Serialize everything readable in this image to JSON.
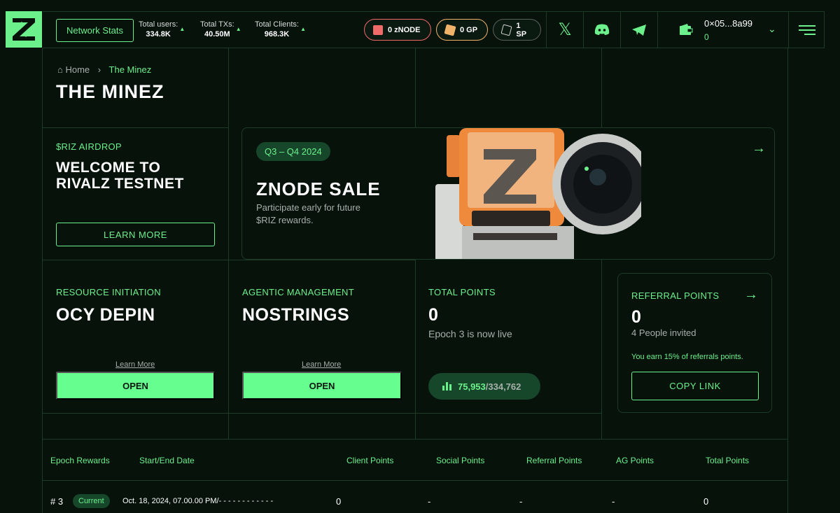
{
  "header": {
    "network_stats_label": "Network Stats",
    "stats": [
      {
        "label": "Total users:",
        "value": "334.8K"
      },
      {
        "label": "Total TXs:",
        "value": "40.50M"
      },
      {
        "label": "Total Clients:",
        "value": "968.3K"
      }
    ],
    "pills": [
      {
        "icon": "znode-icon",
        "label": "0 zNODE",
        "color": "#f06a6a"
      },
      {
        "icon": "gp-icon",
        "label": "0 GP",
        "color": "#f0b36a"
      },
      {
        "icon": "sp-icon",
        "label": "1 SP",
        "color": "#9aa09c"
      }
    ],
    "wallet": {
      "address": "0×05...8a99",
      "balance": "0"
    }
  },
  "breadcrumb": {
    "home": "Home",
    "separator": "›",
    "current": "The Minez"
  },
  "page_title": "THE MINEZ",
  "airdrop": {
    "label": "$RIZ AIRDROP",
    "title_line1": "WELCOME TO",
    "title_line2": "RIVALZ TESTNET",
    "button": "LEARN MORE"
  },
  "sale": {
    "badge": "Q3 – Q4 2024",
    "title": "ZNODE SALE",
    "desc_line1": "Participate early for future",
    "desc_line2": "$RIZ rewards."
  },
  "resource": {
    "label": "RESOURCE INITIATION",
    "title": "OCY DEPIN",
    "link": "Learn More",
    "button": "OPEN"
  },
  "agentic": {
    "label": "AGENTIC MANAGEMENT",
    "title": "NOSTRINGS",
    "link": "Learn More",
    "button": "OPEN"
  },
  "total_points": {
    "label": "TOTAL POINTS",
    "value": "0",
    "epoch_note": "Epoch 3 is now live",
    "rank": "75,953",
    "rank_total": "/334,762"
  },
  "referral": {
    "label": "REFERRAL POINTS",
    "value": "0",
    "invited": "4 People invited",
    "earn_note": "You earn 15% of referrals points.",
    "button": "COPY LINK"
  },
  "table": {
    "headers": [
      "Epoch Rewards",
      "Start/End Date",
      "Client Points",
      "Social Points",
      "Referral Points",
      "AG Points",
      "Total Points"
    ],
    "row": {
      "epoch": "# 3",
      "badge": "Current",
      "date": "Oct. 18, 2024, 07.00.00 PM/- - - - - - - - - - - -",
      "client": "0",
      "social": "-",
      "referral": "-",
      "ag": "-",
      "total": "0"
    }
  },
  "colors": {
    "accent": "#6cf08c",
    "background": "#07120b",
    "button": "#66ff8f"
  }
}
